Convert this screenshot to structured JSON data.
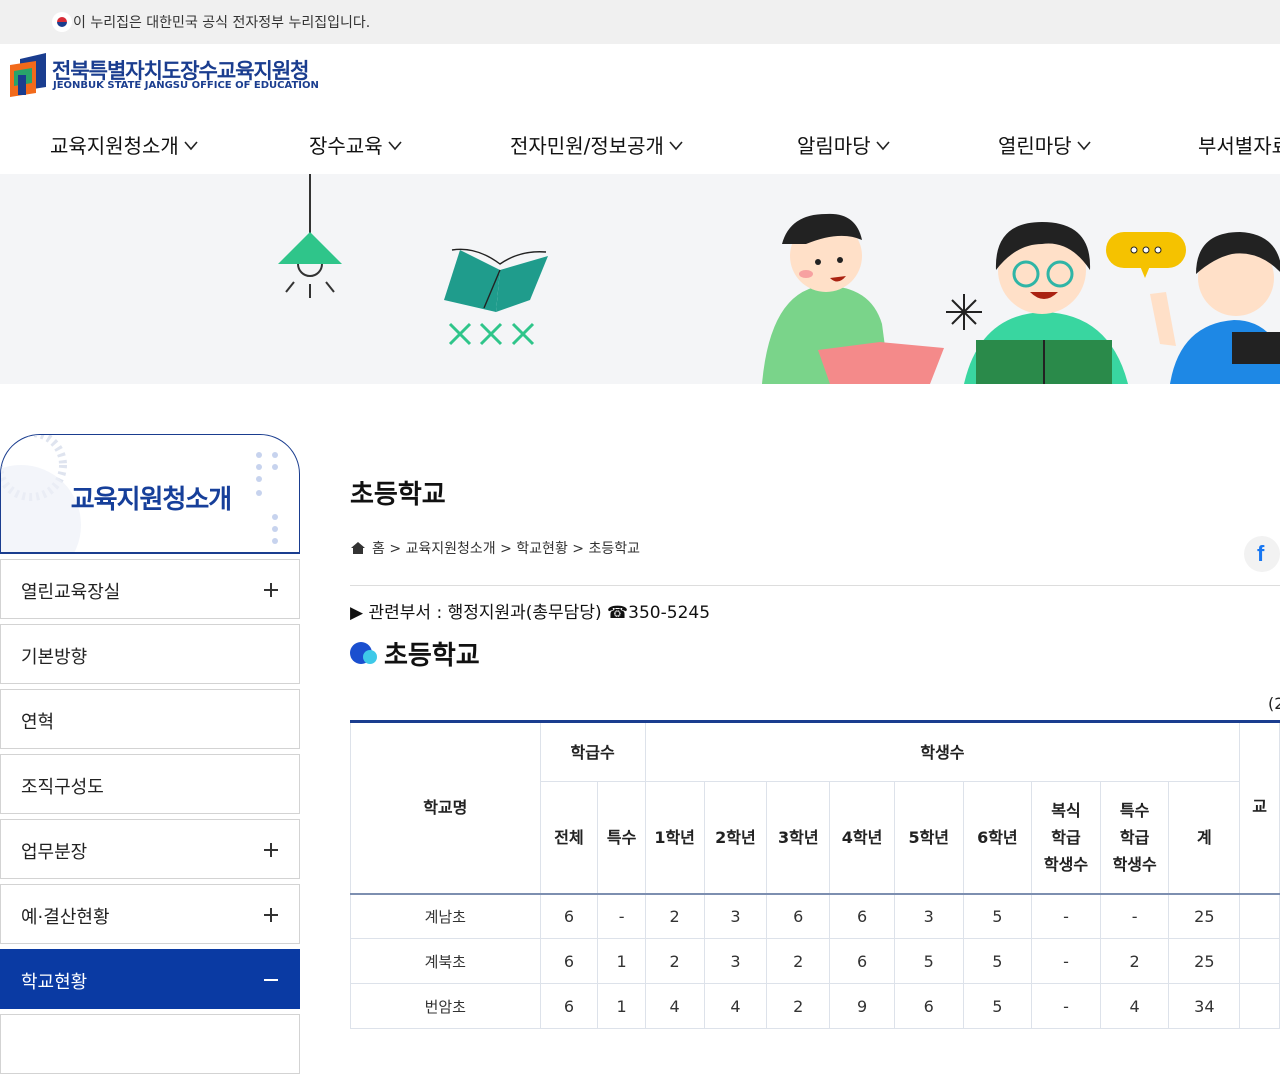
{
  "gov_banner": {
    "text": "이 누리집은 대한민국 공식 전자정부 누리집입니다."
  },
  "logo": {
    "name_ko": "전북특별자치도장수교육지원청",
    "name_en": "JEONBUK STATE JANGSU OFFICE OF EDUCATION"
  },
  "gnb": [
    {
      "label": "교육지원청소개"
    },
    {
      "label": "장수교육"
    },
    {
      "label": "전자민원/정보공개"
    },
    {
      "label": "알림마당"
    },
    {
      "label": "열린마당"
    },
    {
      "label": "부서별자료"
    }
  ],
  "snb": {
    "title": "교육지원청소개",
    "items": [
      {
        "label": "열린교육장실",
        "has_children": true
      },
      {
        "label": "기본방향",
        "has_children": false
      },
      {
        "label": "연혁",
        "has_children": false
      },
      {
        "label": "조직구성도",
        "has_children": false
      },
      {
        "label": "업무분장",
        "has_children": true
      },
      {
        "label": "예·결산현황",
        "has_children": true
      },
      {
        "label": "학교현황",
        "has_children": true,
        "active": true
      }
    ]
  },
  "content": {
    "page_title": "초등학교",
    "breadcrumb": "홈 > 교육지원청소개 > 학교현황 > 초등학교",
    "dept": "▶ 관련부서 : 행정지원과(총무담당) ☎350-5245",
    "section_title": "초등학교",
    "unit_fragment": "(2",
    "table": {
      "headers": {
        "school": "학교명",
        "classes": "학급수",
        "students": "학생수",
        "class_total": "전체",
        "class_special": "특수",
        "grades": [
          "1학년",
          "2학년",
          "3학년",
          "4학년",
          "5학년",
          "6학년"
        ],
        "multi_line1": "복식",
        "multi_line2": "학급",
        "multi_line3": "학생수",
        "special_line1": "특수",
        "special_line2": "학급",
        "special_line3": "학생수",
        "sum": "계",
        "cut_col": "교"
      },
      "rows": [
        {
          "name": "계남초",
          "total": "6",
          "special": "-",
          "g1": "2",
          "g2": "3",
          "g3": "6",
          "g4": "6",
          "g5": "3",
          "g6": "5",
          "multi": "-",
          "special_students": "-",
          "sum": "25"
        },
        {
          "name": "계북초",
          "total": "6",
          "special": "1",
          "g1": "2",
          "g2": "3",
          "g3": "2",
          "g4": "6",
          "g5": "5",
          "g6": "5",
          "multi": "-",
          "special_students": "2",
          "sum": "25"
        },
        {
          "name": "번암초",
          "total": "6",
          "special": "1",
          "g1": "4",
          "g2": "4",
          "g3": "2",
          "g4": "9",
          "g5": "6",
          "g6": "5",
          "multi": "-",
          "special_students": "4",
          "sum": "34"
        }
      ]
    }
  }
}
